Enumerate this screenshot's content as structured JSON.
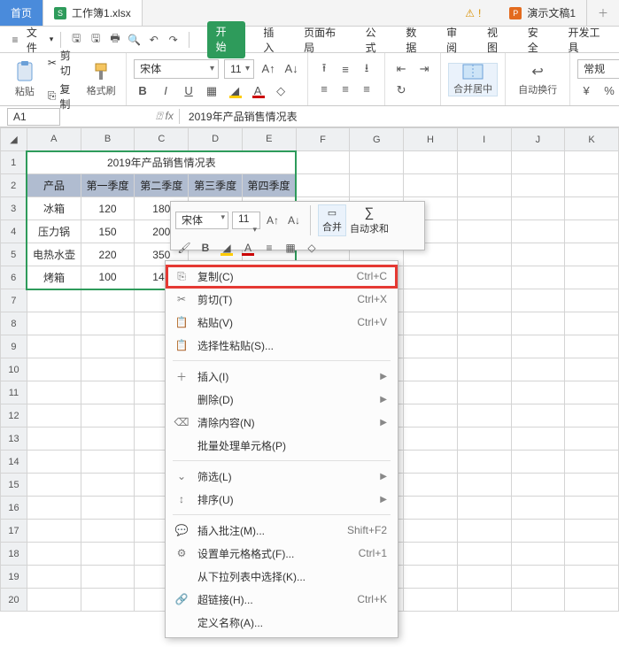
{
  "tabs": {
    "home": "首页",
    "workbook": "工作簿1.xlsx",
    "ppt": "演示文稿1",
    "warn": "!"
  },
  "menubar": {
    "file": "文件"
  },
  "ribbon_tabs": [
    "开始",
    "插入",
    "页面布局",
    "公式",
    "数据",
    "审阅",
    "视图",
    "安全",
    "开发工具"
  ],
  "ribbon": {
    "paste": "粘贴",
    "cut": "剪切",
    "copy": "复制",
    "fmt_painter": "格式刷",
    "font_name": "宋体",
    "font_size": "11",
    "merge": "合并居中",
    "wrap": "自动换行",
    "style": "常规"
  },
  "namebox": "A1",
  "formula": "2019年产品销售情况表",
  "columns": [
    "A",
    "B",
    "C",
    "D",
    "E",
    "F",
    "G",
    "H",
    "I",
    "J",
    "K"
  ],
  "row_count": 20,
  "chart_data": {
    "type": "table",
    "title": "2019年产品销售情况表",
    "headers": [
      "产品",
      "第一季度",
      "第二季度",
      "第三季度",
      "第四季度"
    ],
    "rows": [
      {
        "c0": "冰箱",
        "c1": "120",
        "c2": "180",
        "c3": "",
        "c4": ""
      },
      {
        "c0": "压力锅",
        "c1": "150",
        "c2": "200",
        "c3": "",
        "c4": ""
      },
      {
        "c0": "电热水壶",
        "c1": "220",
        "c2": "350",
        "c3": "",
        "c4": ""
      },
      {
        "c0": "烤箱",
        "c1": "100",
        "c2": "140",
        "c3": "",
        "c4": ""
      }
    ]
  },
  "mini": {
    "font_name": "宋体",
    "font_size": "11",
    "merge": "合并",
    "sum": "自动求和"
  },
  "ctx": [
    {
      "ico": "copy",
      "label": "复制(C)",
      "shortcut": "Ctrl+C",
      "hl": true
    },
    {
      "ico": "cut",
      "label": "剪切(T)",
      "shortcut": "Ctrl+X"
    },
    {
      "ico": "paste",
      "label": "粘贴(V)",
      "shortcut": "Ctrl+V"
    },
    {
      "ico": "paste-special",
      "label": "选择性粘贴(S)..."
    },
    {
      "sep": true
    },
    {
      "ico": "insert",
      "label": "插入(I)",
      "sub": true
    },
    {
      "ico": "",
      "label": "删除(D)",
      "sub": true
    },
    {
      "ico": "clear",
      "label": "清除内容(N)",
      "sub": true
    },
    {
      "ico": "",
      "label": "批量处理单元格(P)"
    },
    {
      "sep": true
    },
    {
      "ico": "filter",
      "label": "筛选(L)",
      "sub": true
    },
    {
      "ico": "sort",
      "label": "排序(U)",
      "sub": true
    },
    {
      "sep": true
    },
    {
      "ico": "comment",
      "label": "插入批注(M)...",
      "shortcut": "Shift+F2"
    },
    {
      "ico": "format",
      "label": "设置单元格格式(F)...",
      "shortcut": "Ctrl+1"
    },
    {
      "ico": "",
      "label": "从下拉列表中选择(K)..."
    },
    {
      "ico": "link",
      "label": "超链接(H)...",
      "shortcut": "Ctrl+K"
    },
    {
      "ico": "",
      "label": "定义名称(A)..."
    }
  ]
}
